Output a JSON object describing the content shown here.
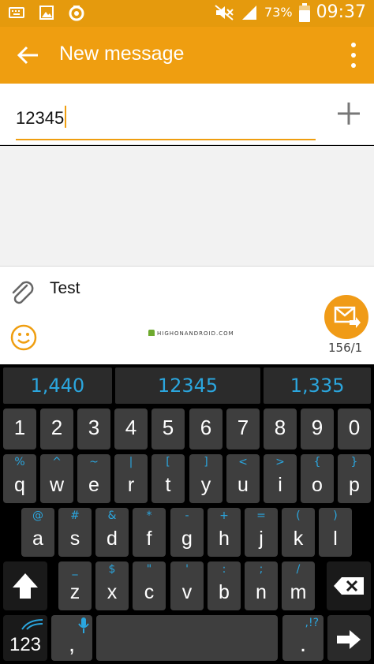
{
  "status_bar": {
    "battery_percent": "73%",
    "time": "09:37"
  },
  "app_bar": {
    "title": "New message"
  },
  "recipient": {
    "value": "12345"
  },
  "compose": {
    "text": "Test",
    "watermark": "HIGHONANDROID.COM",
    "char_counter": "156/1"
  },
  "keyboard": {
    "suggestions": [
      "1,440",
      "12345",
      "1,335"
    ],
    "number_row": [
      "1",
      "2",
      "3",
      "4",
      "5",
      "6",
      "7",
      "8",
      "9",
      "0"
    ],
    "row_q": [
      {
        "main": "q",
        "alt": "%"
      },
      {
        "main": "w",
        "alt": "^"
      },
      {
        "main": "e",
        "alt": "~"
      },
      {
        "main": "r",
        "alt": "|"
      },
      {
        "main": "t",
        "alt": "["
      },
      {
        "main": "y",
        "alt": "]"
      },
      {
        "main": "u",
        "alt": "<"
      },
      {
        "main": "i",
        "alt": ">"
      },
      {
        "main": "o",
        "alt": "{"
      },
      {
        "main": "p",
        "alt": "}"
      }
    ],
    "row_a": [
      {
        "main": "a",
        "alt": "@"
      },
      {
        "main": "s",
        "alt": "#"
      },
      {
        "main": "d",
        "alt": "&"
      },
      {
        "main": "f",
        "alt": "*"
      },
      {
        "main": "g",
        "alt": "-"
      },
      {
        "main": "h",
        "alt": "+"
      },
      {
        "main": "j",
        "alt": "="
      },
      {
        "main": "k",
        "alt": "("
      },
      {
        "main": "l",
        "alt": ")"
      }
    ],
    "row_z": [
      {
        "main": "z",
        "alt": "_"
      },
      {
        "main": "x",
        "alt": "$"
      },
      {
        "main": "c",
        "alt": "\""
      },
      {
        "main": "v",
        "alt": "'"
      },
      {
        "main": "b",
        "alt": ":"
      },
      {
        "main": "n",
        "alt": ";"
      },
      {
        "main": "m",
        "alt": "/"
      }
    ],
    "symbols_key": "123",
    "comma_key": ",",
    "period_key": ".",
    "period_alt": ",!?"
  },
  "colors": {
    "status_bar": "#e59a0d",
    "app_bar": "#ef9e10",
    "accent_blue": "#2ba6de",
    "key_bg": "#3e3e3e"
  }
}
